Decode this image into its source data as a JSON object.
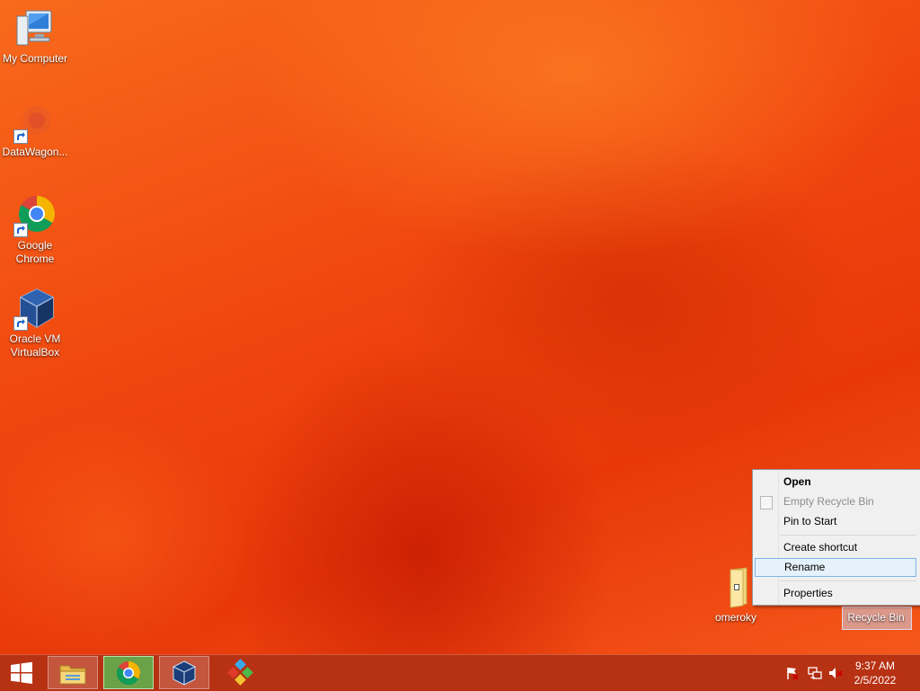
{
  "desktop": {
    "icons": [
      {
        "label": "My Computer",
        "icon": "computer-icon"
      },
      {
        "label": "DataWagon...",
        "icon": "datawagon-icon"
      },
      {
        "label": "Google Chrome",
        "icon": "chrome-icon"
      },
      {
        "label": "Oracle VM VirtualBox",
        "icon": "virtualbox-icon"
      },
      {
        "label": "omeroky",
        "icon": "folder-icon"
      },
      {
        "label": "Recycle Bin",
        "icon": "recycle-bin-icon"
      }
    ]
  },
  "context_menu": {
    "items": [
      {
        "label": "Open",
        "style": "bold"
      },
      {
        "label": "Empty Recycle Bin",
        "style": "disabled"
      },
      {
        "label": "Pin to Start"
      },
      {
        "label": "Create shortcut"
      },
      {
        "label": "Rename",
        "style": "highlighted"
      },
      {
        "label": "Properties"
      }
    ]
  },
  "taskbar": {
    "buttons": [
      {
        "icon": "windows-start-icon"
      },
      {
        "icon": "file-explorer-icon"
      },
      {
        "icon": "chrome-icon"
      },
      {
        "icon": "virtualbox-icon"
      },
      {
        "icon": "app-cubes-icon"
      }
    ],
    "tray": [
      {
        "icon": "action-center-flag-icon"
      },
      {
        "icon": "network-icon"
      },
      {
        "icon": "volume-muted-icon"
      }
    ],
    "clock": {
      "time": "9:37 AM",
      "date": "2/5/2022"
    }
  },
  "colors": {
    "accent": "#f45a12",
    "taskbar": "#aa2814",
    "menu_highlight": "#e5f1fb"
  }
}
